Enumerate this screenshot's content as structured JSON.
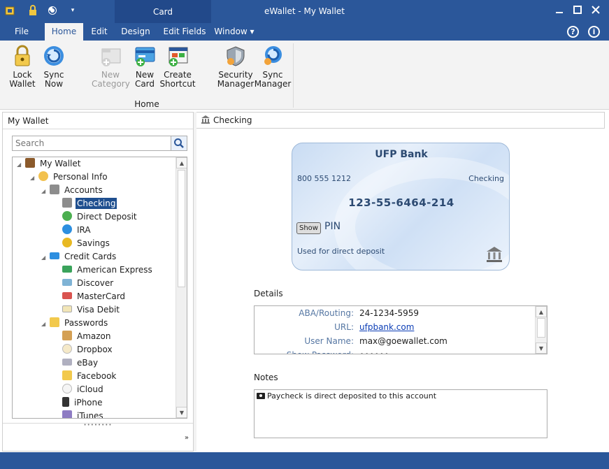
{
  "title_bar": {
    "title": "eWallet - My Wallet",
    "context_tab_group": "Card"
  },
  "tabs": [
    {
      "label": "File"
    },
    {
      "label": "Home"
    },
    {
      "label": "Edit"
    },
    {
      "label": "Design"
    },
    {
      "label": "Edit Fields"
    },
    {
      "label": "Window ▾"
    }
  ],
  "ribbon": {
    "buttons": [
      {
        "label_1": "Lock",
        "label_2": "Wallet",
        "icon": "lock-icon"
      },
      {
        "label_1": "Sync",
        "label_2": "Now",
        "icon": "sync-icon"
      },
      {
        "label_1": "New",
        "label_2": "Category",
        "icon": "new-category-icon"
      },
      {
        "label_1": "New",
        "label_2": "Card",
        "icon": "new-card-icon"
      },
      {
        "label_1": "Create",
        "label_2": "Shortcut",
        "icon": "shortcut-icon"
      },
      {
        "label_1": "Security",
        "label_2": "Manager",
        "icon": "security-manager-icon"
      },
      {
        "label_1": "Sync",
        "label_2": "Manager",
        "icon": "sync-manager-icon"
      }
    ],
    "group_label": "Home"
  },
  "left_pane": {
    "header": "My Wallet",
    "search_placeholder": "Search",
    "tree": [
      {
        "label": "My Wallet",
        "icon": "wallet-icon"
      },
      {
        "label": "Personal Info",
        "icon": "person-icon"
      },
      {
        "label": "Accounts",
        "icon": "bank-icon"
      },
      {
        "label": "Checking",
        "icon": "bank-icon"
      },
      {
        "label": "Direct Deposit",
        "icon": "hash-icon"
      },
      {
        "label": "IRA",
        "icon": "info-icon"
      },
      {
        "label": "Savings",
        "icon": "coins-icon"
      },
      {
        "label": "Credit Cards",
        "icon": "credit-card-icon"
      },
      {
        "label": "American Express",
        "icon": "amex-icon"
      },
      {
        "label": "Discover",
        "icon": "discover-icon"
      },
      {
        "label": "MasterCard",
        "icon": "mastercard-icon"
      },
      {
        "label": "Visa Debit",
        "icon": "visa-icon"
      },
      {
        "label": "Passwords",
        "icon": "lock-icon"
      },
      {
        "label": "Amazon",
        "icon": "box-icon"
      },
      {
        "label": "Dropbox",
        "icon": "cloud-icon"
      },
      {
        "label": "eBay",
        "icon": "ebay-icon"
      },
      {
        "label": "Facebook",
        "icon": "lock-icon"
      },
      {
        "label": "iCloud",
        "icon": "cloud-icon"
      },
      {
        "label": "iPhone",
        "icon": "phone-icon"
      },
      {
        "label": "iTunes",
        "icon": "music-icon"
      }
    ]
  },
  "right_pane": {
    "header": "Checking",
    "card": {
      "bank": "UFP Bank",
      "phone": "800 555 1212",
      "type": "Checking",
      "number": "123-55-6464-214",
      "show_button": "Show",
      "pin_label": "PIN",
      "description": "Used for direct deposit"
    },
    "details_label": "Details",
    "details": [
      {
        "key": "ABA/Routing:",
        "value": "24-1234-5959"
      },
      {
        "key": "URL:",
        "value": "ufpbank.com"
      },
      {
        "key": "User Name:",
        "value": "max@goewallet.com"
      },
      {
        "key": "Show Password:",
        "value": "••••••"
      }
    ],
    "notes_label": "Notes",
    "notes_text": "Paycheck is direct deposited to this account"
  },
  "colors": {
    "brand_blue": "#2b579a",
    "selected": "#1f4f8f",
    "link": "#0b3db5"
  }
}
